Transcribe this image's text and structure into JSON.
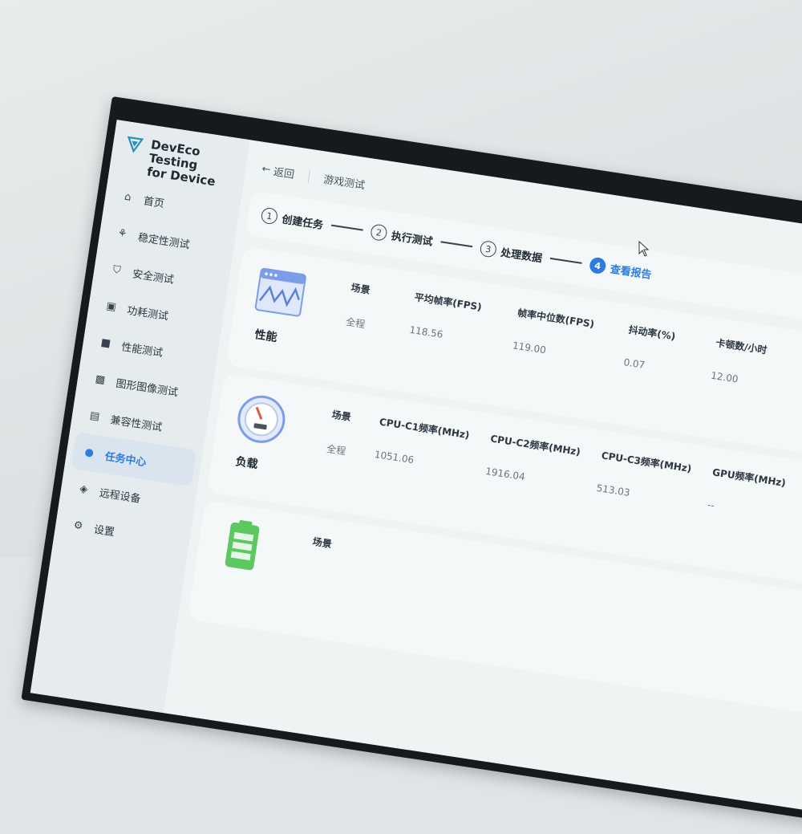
{
  "app": {
    "name_line1": "DevEco Testing",
    "name_line2": "for Device"
  },
  "sidebar": {
    "items": [
      {
        "label": "首页",
        "icon": "home-icon"
      },
      {
        "label": "稳定性测试",
        "icon": "stability-icon"
      },
      {
        "label": "安全测试",
        "icon": "shield-icon"
      },
      {
        "label": "功耗测试",
        "icon": "power-icon"
      },
      {
        "label": "性能测试",
        "icon": "performance-icon"
      },
      {
        "label": "图形图像测试",
        "icon": "image-icon"
      },
      {
        "label": "兼容性测试",
        "icon": "compat-icon"
      },
      {
        "label": "任务中心",
        "icon": "user-task-icon",
        "active": true
      },
      {
        "label": "远程设备",
        "icon": "cube-icon"
      },
      {
        "label": "设置",
        "icon": "gear-icon"
      }
    ]
  },
  "topbar": {
    "back_label": "返回",
    "title": "游戏测试"
  },
  "steps": [
    {
      "num": "1",
      "label": "创建任务"
    },
    {
      "num": "2",
      "label": "执行测试"
    },
    {
      "num": "3",
      "label": "处理数据"
    },
    {
      "num": "4",
      "label": "查看报告",
      "current": true
    }
  ],
  "cards": [
    {
      "title": "性能",
      "icon": "waveform-window-icon",
      "columns": [
        "场景",
        "平均帧率(FPS)",
        "帧率中位数(FPS)",
        "抖动率(%)",
        "卡顿数/小时"
      ],
      "values": [
        "全程",
        "118.56",
        "119.00",
        "0.07",
        "12.00"
      ]
    },
    {
      "title": "负载",
      "icon": "gauge-icon",
      "columns": [
        "场景",
        "CPU-C1频率(MHz)",
        "CPU-C2频率(MHz)",
        "CPU-C3频率(MHz)",
        "GPU频率(MHz)"
      ],
      "values": [
        "全程",
        "1051.06",
        "1916.04",
        "513.03",
        "--"
      ]
    },
    {
      "title": "",
      "icon": "battery-icon",
      "columns": [
        "场景"
      ],
      "values": []
    }
  ],
  "colors": {
    "accent": "#2d7de0",
    "bezel": "#16191d",
    "wall": "#dfe5e6"
  }
}
